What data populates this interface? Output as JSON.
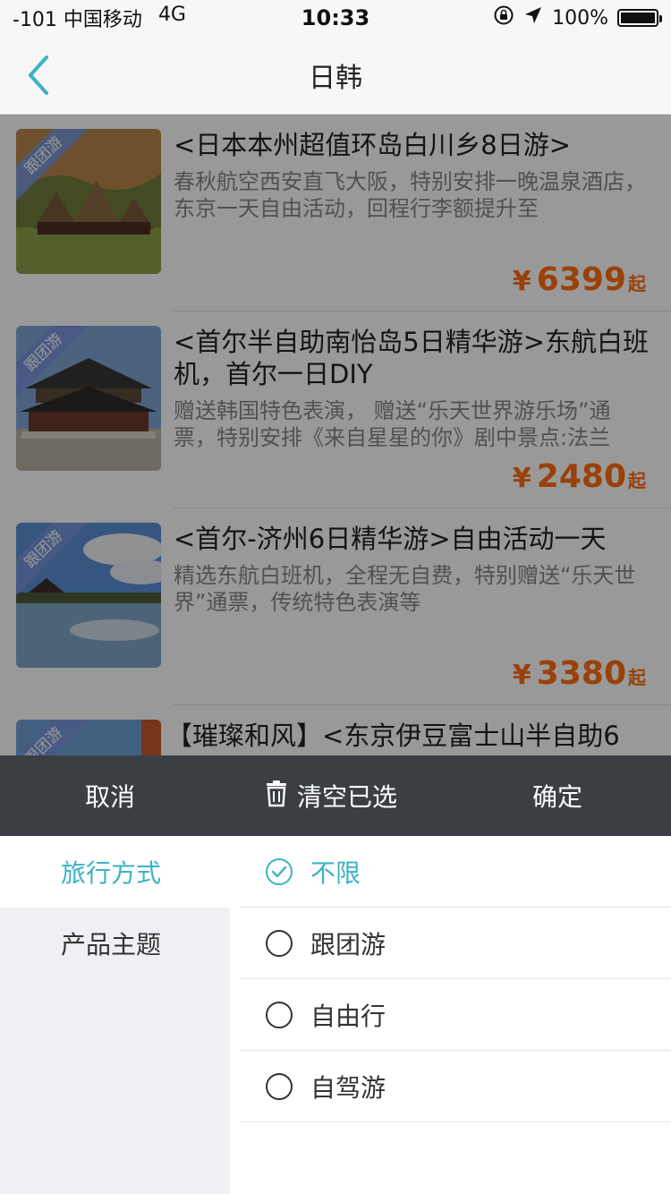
{
  "status_bar": {
    "carrier": "-101 中国移动",
    "network": "4G",
    "time": "10:33",
    "battery": "100%",
    "battery_level": 1.0
  },
  "nav": {
    "title": "日韩",
    "back_icon": "chevron-left-icon",
    "accent_color": "#3bb3c3"
  },
  "products": [
    {
      "badge": "跟团游",
      "title": "<日本本州超值环岛白川乡8日游>",
      "desc": "春秋航空西安直飞大阪，特别安排一晚温泉酒店，东京一天自由活动，回程行李额提升至",
      "currency": "¥",
      "price": "6399",
      "suffix": "起"
    },
    {
      "badge": "跟团游",
      "title": "<首尔半自助南怡岛5日精华游>东航白班机，首尔一日DIY",
      "desc": "赠送韩国特色表演， 赠送“乐天世界游乐场”通票，特别安排《来自星星的你》剧中景点:法兰",
      "currency": "¥",
      "price": "2480",
      "suffix": "起"
    },
    {
      "badge": "跟团游",
      "title": "<首尔-济州6日精华游>自由活动一天",
      "desc": "精选东航白班机，全程无自费，特别赠送“乐天世界”通票，传统特色表演等",
      "currency": "¥",
      "price": "3380",
      "suffix": "起"
    },
    {
      "badge": "跟团游",
      "title": "【璀璨和风】<东京伊豆富士山半自助6",
      "desc": "",
      "currency": "",
      "price": "",
      "suffix": ""
    }
  ],
  "filter": {
    "cancel": "取消",
    "clear": "清空已选",
    "confirm": "确定",
    "categories": [
      "旅行方式",
      "产品主题"
    ],
    "active_category": 0,
    "options": [
      "不限",
      "跟团游",
      "自由行",
      "自驾游"
    ],
    "selected_option": 0
  },
  "colors": {
    "accent": "#3bb3c3",
    "price": "#ff6d10",
    "filter_bar": "#3b3f44"
  }
}
